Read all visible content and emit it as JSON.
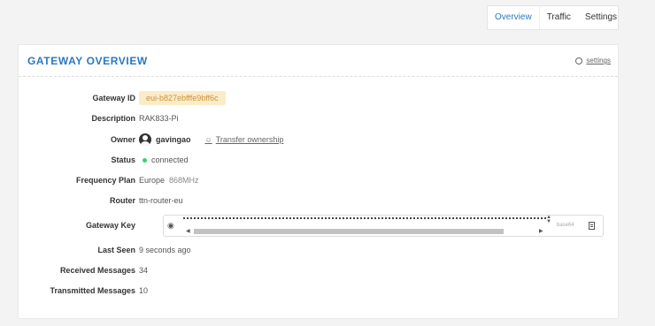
{
  "tabs": [
    {
      "label": "Overview",
      "active": true
    },
    {
      "label": "Traffic",
      "active": false
    },
    {
      "label": "Settings",
      "active": false
    }
  ],
  "card": {
    "title": "GATEWAY OVERVIEW",
    "settings_link": "settings"
  },
  "fields": {
    "gateway_id": {
      "label": "Gateway ID",
      "value": "eui-b827ebfffe9bff6c"
    },
    "description": {
      "label": "Description",
      "value": "RAK833-Pi"
    },
    "owner": {
      "label": "Owner",
      "value": "gavingao",
      "transfer": "Transfer ownership"
    },
    "status": {
      "label": "Status",
      "value": "connected",
      "color": "#3ecf6b"
    },
    "frequency_plan": {
      "label": "Frequency Plan",
      "value": "Europe",
      "sub": "868MHz"
    },
    "router": {
      "label": "Router",
      "value": "ttn-router-eu"
    },
    "gateway_key": {
      "label": "Gateway Key",
      "encoding": "base64"
    },
    "last_seen": {
      "label": "Last Seen",
      "value": "9 seconds ago"
    },
    "received": {
      "label": "Received Messages",
      "value": "34"
    },
    "transmitted": {
      "label": "Transmitted Messages",
      "value": "10"
    }
  },
  "colors": {
    "accent": "#2b78c2",
    "badge_bg": "#fbecc9",
    "badge_text": "#c8943c"
  }
}
